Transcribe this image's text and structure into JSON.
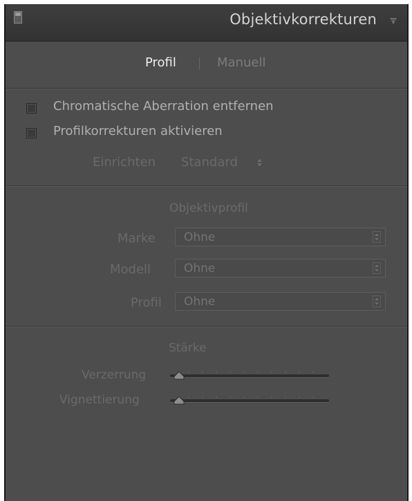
{
  "panel": {
    "title": "Objektivkorrekturen",
    "menu_icon": "triangle-menu-icon",
    "collapse_icon": "panel-toggle-icon"
  },
  "tabs": [
    {
      "label": "Profil",
      "active": true
    },
    {
      "label": "Manuell",
      "active": false
    }
  ],
  "options": {
    "chromatic": {
      "label": "Chromatische Aberration entfernen",
      "checked": false
    },
    "profile_corrections": {
      "label": "Profilkorrekturen aktivieren",
      "checked": false
    }
  },
  "setup": {
    "label": "Einrichten",
    "value": "Standard",
    "icon": "stepper-arrows-icon"
  },
  "lens_profile": {
    "heading": "Objektivprofil",
    "fields": [
      {
        "label": "Marke",
        "value": "Ohne"
      },
      {
        "label": "Modell",
        "value": "Ohne"
      },
      {
        "label": "Profil",
        "value": "Ohne"
      }
    ]
  },
  "amount": {
    "heading": "Stärke",
    "sliders": [
      {
        "label": "Verzerrung",
        "value": 0
      },
      {
        "label": "Vignettierung",
        "value": 0
      }
    ]
  },
  "colors": {
    "panel_bg": "#4d4d4d",
    "header_bg": "#363636",
    "active_text": "#eeeeee",
    "disabled_text": "#6a6a6a"
  }
}
